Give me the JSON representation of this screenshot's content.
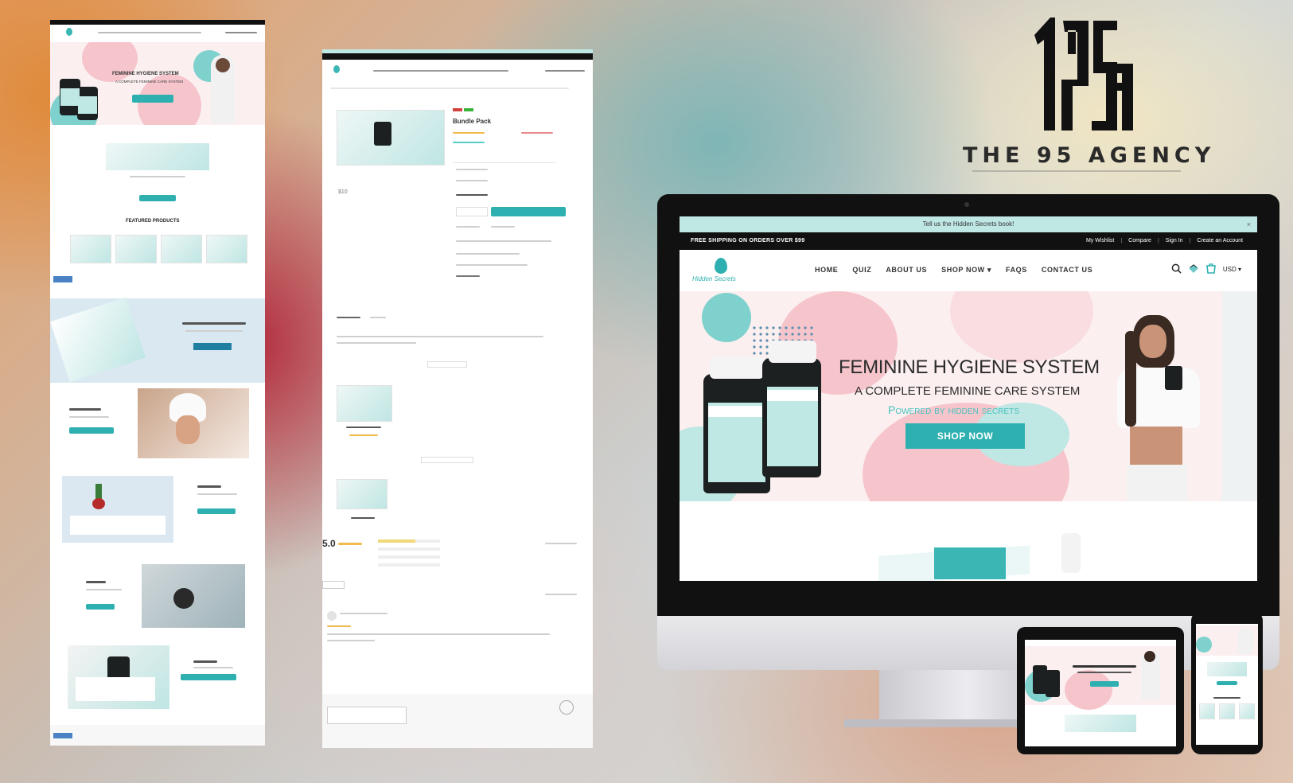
{
  "agency": {
    "mark": "19SA",
    "name": "THE 95 AGENCY"
  },
  "colors": {
    "brand_teal": "#2fb0b0",
    "hero_pink": "#f6c5cc",
    "announce_bg": "#bfe7e4",
    "topbar_bg": "#111111"
  },
  "desktop": {
    "announcement": "Tell us the Hidden Secrets book!",
    "announcement_close": "×",
    "topbar_left": "FREE SHIPPING ON ORDERS OVER $99",
    "topbar_right": [
      "My Wishlist",
      "Compare",
      "Sign In",
      "Create an Account"
    ],
    "logo_text": "Hidden Secrets",
    "nav": [
      "HOME",
      "QUIZ",
      "ABOUT US",
      "SHOP NOW ▾",
      "FAQS",
      "CONTACT US"
    ],
    "icons": [
      "search-icon",
      "wishlist-icon",
      "cart-icon"
    ],
    "currency": "USD ▾",
    "hero": {
      "title": "FEMININE HYGIENE SYSTEM",
      "subtitle": "A COMPLETE FEMININE CARE SYSTEM",
      "tagline": "Powered by hidden secrets",
      "cta": "SHOP NOW"
    }
  },
  "home_page": {
    "hero_title": "FEMININE HYGIENE SYSTEM",
    "hero_subtitle": "A COMPLETE FEMININE CARE SYSTEM",
    "featured_heading": "FEATURED PRODUCTS"
  },
  "product_page": {
    "product_name": "Bundle Pack",
    "sku": "$10",
    "rating": "5.0"
  }
}
